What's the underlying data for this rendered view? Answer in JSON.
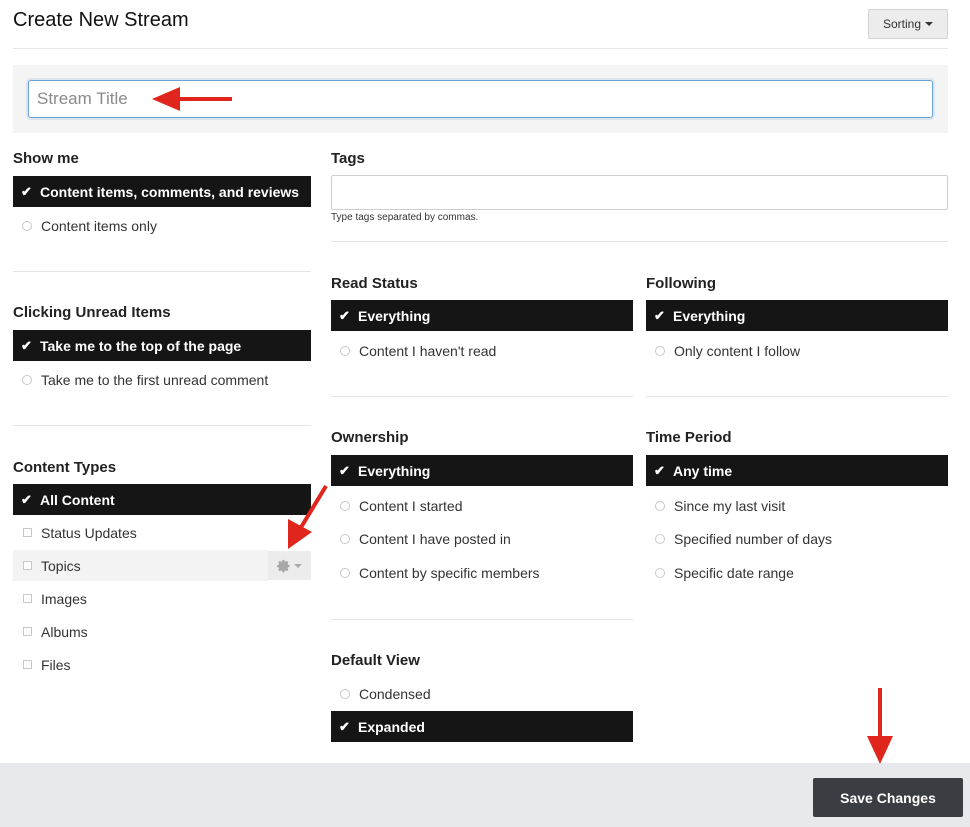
{
  "header": {
    "title": "Create New Stream",
    "sorting_label": "Sorting"
  },
  "stream_title": {
    "placeholder": "Stream Title",
    "value": ""
  },
  "show_me": {
    "title": "Show me",
    "options": [
      {
        "label": "Content items, comments, and reviews",
        "selected": true
      },
      {
        "label": "Content items only",
        "selected": false
      }
    ]
  },
  "clicking_unread": {
    "title": "Clicking Unread Items",
    "options": [
      {
        "label": "Take me to the top of the page",
        "selected": true
      },
      {
        "label": "Take me to the first unread comment",
        "selected": false
      }
    ]
  },
  "content_types": {
    "title": "Content Types",
    "options": [
      {
        "label": "All Content",
        "selected": true
      },
      {
        "label": "Status Updates",
        "selected": false
      },
      {
        "label": "Topics",
        "selected": false
      },
      {
        "label": "Images",
        "selected": false
      },
      {
        "label": "Albums",
        "selected": false
      },
      {
        "label": "Files",
        "selected": false
      }
    ]
  },
  "tags": {
    "title": "Tags",
    "help": "Type tags separated by commas.",
    "value": ""
  },
  "read_status": {
    "title": "Read Status",
    "options": [
      {
        "label": "Everything",
        "selected": true
      },
      {
        "label": "Content I haven't read",
        "selected": false
      }
    ]
  },
  "following": {
    "title": "Following",
    "options": [
      {
        "label": "Everything",
        "selected": true
      },
      {
        "label": "Only content I follow",
        "selected": false
      }
    ]
  },
  "ownership": {
    "title": "Ownership",
    "options": [
      {
        "label": "Everything",
        "selected": true
      },
      {
        "label": "Content I started",
        "selected": false
      },
      {
        "label": "Content I have posted in",
        "selected": false
      },
      {
        "label": "Content by specific members",
        "selected": false
      }
    ]
  },
  "time_period": {
    "title": "Time Period",
    "options": [
      {
        "label": "Any time",
        "selected": true
      },
      {
        "label": "Since my last visit",
        "selected": false
      },
      {
        "label": "Specified number of days",
        "selected": false
      },
      {
        "label": "Specific date range",
        "selected": false
      }
    ]
  },
  "default_view": {
    "title": "Default View",
    "options": [
      {
        "label": "Condensed",
        "selected": false
      },
      {
        "label": "Expanded",
        "selected": true
      }
    ]
  },
  "footer": {
    "save_label": "Save Changes"
  },
  "colors": {
    "selected_bg": "#151515",
    "save_bg": "#3a3d42",
    "annotation_arrow": "#e0261c",
    "input_focus": "#6aa2d8"
  },
  "icons": {
    "check": "checkmark-icon",
    "gear": "gear-icon",
    "caret": "caret-down-icon",
    "annotation": "red-arrow-annotation"
  }
}
